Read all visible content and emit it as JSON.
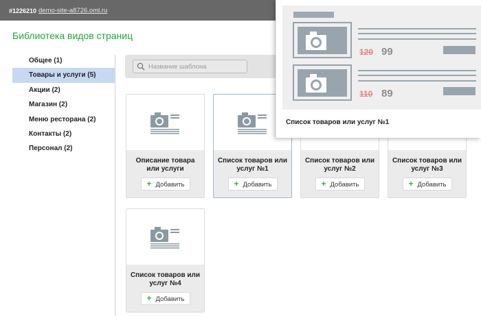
{
  "topbar": {
    "site_id": "#1226210",
    "site_link": "demo-site-a8726.oml.ru"
  },
  "page": {
    "title": "Библиотека видов страниц"
  },
  "sidebar": {
    "items": [
      {
        "label": "Общее (1)"
      },
      {
        "label": "Товары и услуги (5)",
        "active": true
      },
      {
        "label": "Акции (2)"
      },
      {
        "label": "Магазин (2)"
      },
      {
        "label": "Меню ресторана (2)"
      },
      {
        "label": "Контакты (2)"
      },
      {
        "label": "Персонал (2)"
      }
    ]
  },
  "search": {
    "placeholder": "Название шаблона",
    "value": ""
  },
  "cards": [
    {
      "name": "Описание товара или услуги",
      "add_label": "Добавить"
    },
    {
      "name": "Список товаров или услуг №1",
      "add_label": "Добавить"
    },
    {
      "name": "Список товаров или услуг №2",
      "add_label": "Добавить"
    },
    {
      "name": "Список товаров или услуг №3",
      "add_label": "Добавить"
    },
    {
      "name": "Список товаров или услуг №4",
      "add_label": "Добавить"
    }
  ],
  "popup": {
    "title": "Список товаров или услуг №1",
    "items": [
      {
        "old_price": "120",
        "new_price": "99"
      },
      {
        "old_price": "110",
        "new_price": "89"
      }
    ]
  },
  "colors": {
    "accent": "#21a53c",
    "topbar": "#686868",
    "active_item": "#c6d9f1",
    "old_price": "#e08585",
    "add_plus": "#2db44a"
  },
  "icons": {
    "search": "search-icon",
    "thumbnail": "camera-icon",
    "add": "plus-icon"
  }
}
